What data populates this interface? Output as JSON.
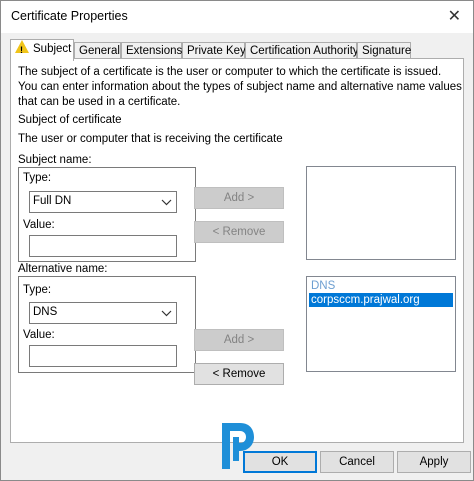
{
  "window": {
    "title": "Certificate Properties",
    "close_glyph": "✕"
  },
  "tabs": [
    {
      "label": "Subject",
      "active": true
    },
    {
      "label": "General"
    },
    {
      "label": "Extensions"
    },
    {
      "label": "Private Key"
    },
    {
      "label": "Certification Authority"
    },
    {
      "label": "Signature"
    }
  ],
  "subject_tab": {
    "description": "The subject of a certificate is the user or computer to which the certificate is issued. You can enter information about the types of subject name and alternative name values that can be used in a certificate.",
    "section_heading": "Subject of certificate",
    "section_subheading": "The user or computer that is receiving the certificate",
    "subject_name": {
      "label": "Subject name:",
      "type_label": "Type:",
      "type_value": "Full DN",
      "value_label": "Value:",
      "value": ""
    },
    "alternative_name": {
      "label": "Alternative name:",
      "type_label": "Type:",
      "type_value": "DNS",
      "value_label": "Value:",
      "value": ""
    },
    "add_label": "Add >",
    "remove_label": "< Remove",
    "alt_list": {
      "header": "DNS",
      "items": [
        "corpsccm.prajwal.org"
      ]
    }
  },
  "footer": {
    "ok": "OK",
    "cancel": "Cancel",
    "apply": "Apply"
  },
  "colors": {
    "selection": "#0078d7",
    "logo": "#1f8fd8"
  }
}
